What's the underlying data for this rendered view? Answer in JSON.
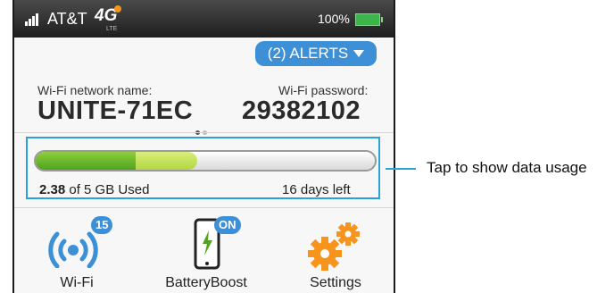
{
  "status": {
    "carrier": "AT&T",
    "network": "4G",
    "network_sub": "LTE",
    "battery_percent": "100%",
    "battery_level": 1.0
  },
  "alerts": {
    "label": "(2) ALERTS"
  },
  "wifi_network": {
    "name_label": "Wi-Fi network name:",
    "name": "UNITE-71EC"
  },
  "wifi_password": {
    "label": "Wi-Fi password:",
    "value": "29382102"
  },
  "page_indicator": {
    "count": 2,
    "active": 0
  },
  "usage": {
    "used_amount": "2.38",
    "used_suffix": "of 5 GB Used",
    "used_gb": 2.38,
    "total_gb": 5,
    "days_left": "16 days left"
  },
  "tiles": [
    {
      "label": "Wi-Fi",
      "badge": "15",
      "icon": "wifi-broadcast-icon"
    },
    {
      "label": "BatteryBoost",
      "badge": "ON",
      "icon": "battery-boost-phone-icon"
    },
    {
      "label": "Settings",
      "icon": "gears-icon"
    }
  ],
  "callout": {
    "text": "Tap to show data usage"
  },
  "colors": {
    "accent_blue": "#3d8fd6",
    "usage_green": "#4fa31e",
    "gear_orange": "#f7941d",
    "highlight_cyan": "#29a3dc"
  }
}
